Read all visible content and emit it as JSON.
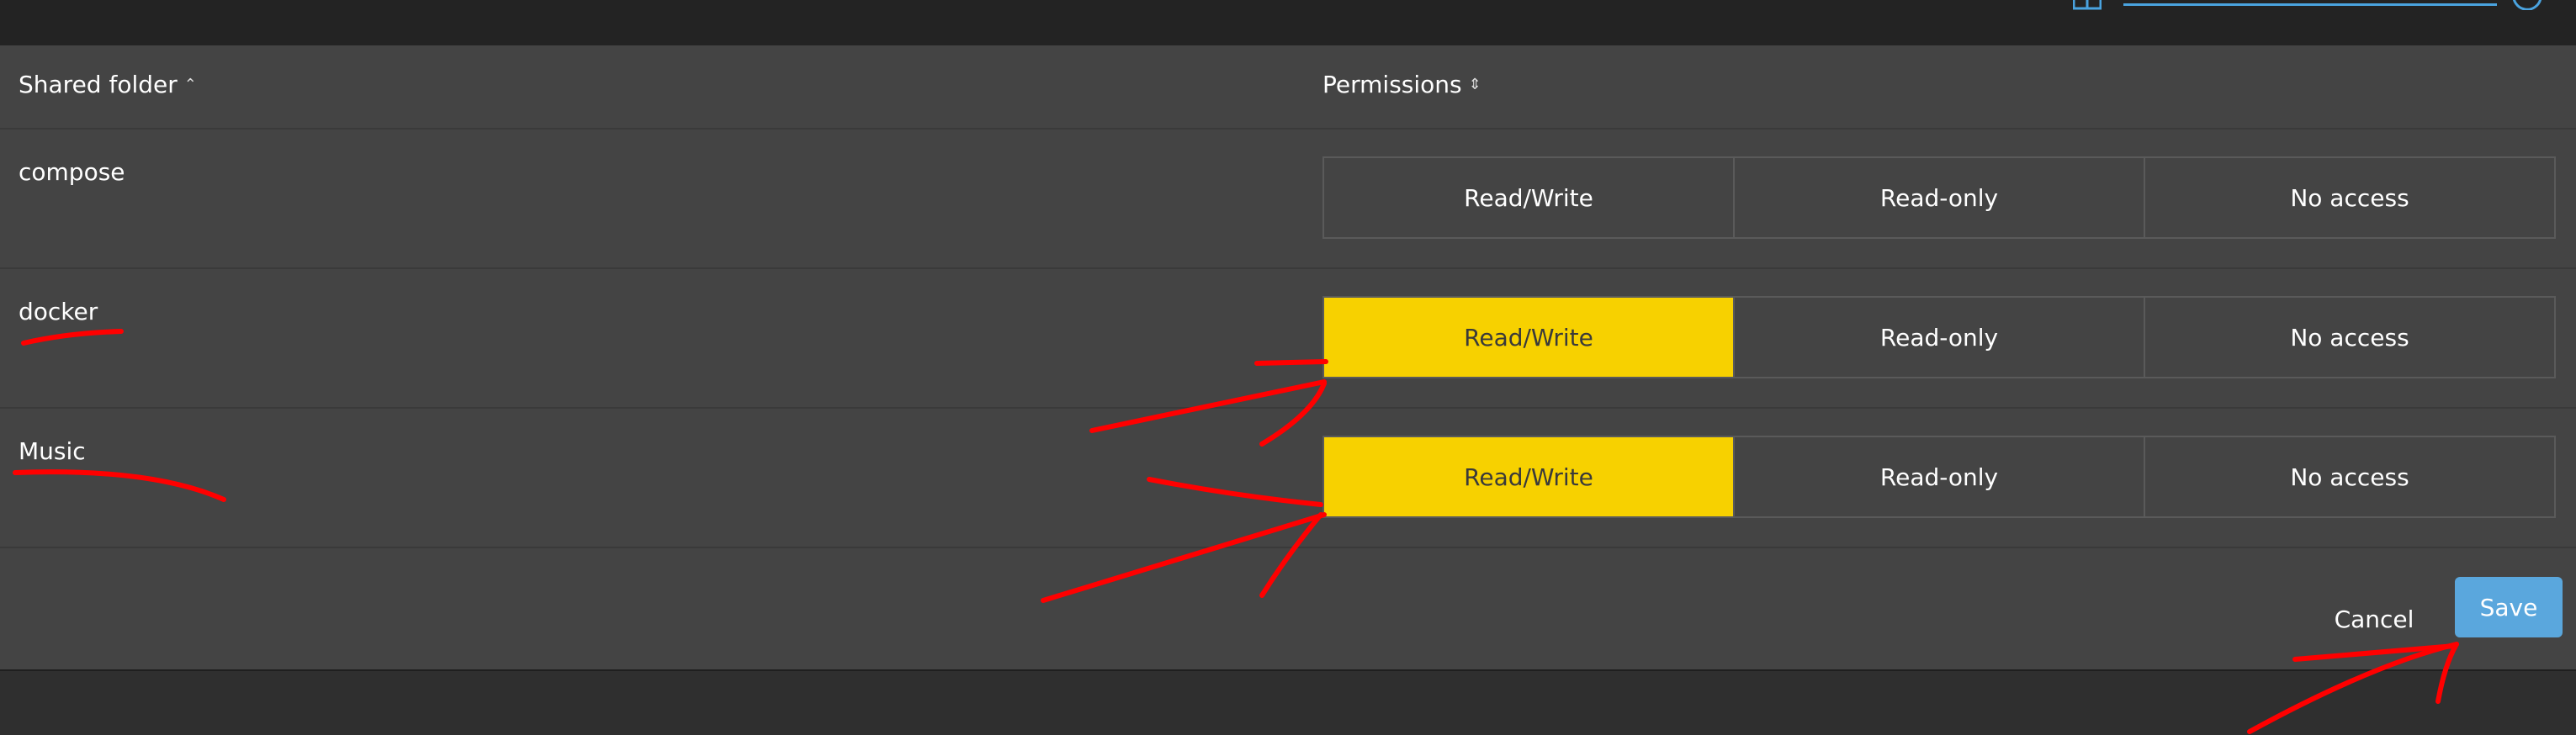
{
  "table": {
    "header": {
      "folder_label": "Shared folder",
      "folder_sort_icon": "chevron-up-icon",
      "permissions_label": "Permissions",
      "permissions_sort_icon": "sort-updown-icon"
    },
    "rows": [
      {
        "name": "compose",
        "options": [
          "Read/Write",
          "Read-only",
          "No access"
        ],
        "selected": ""
      },
      {
        "name": "docker",
        "options": [
          "Read/Write",
          "Read-only",
          "No access"
        ],
        "selected": "Read/Write"
      },
      {
        "name": "Music",
        "options": [
          "Read/Write",
          "Read-only",
          "No access"
        ],
        "selected": "Read/Write"
      }
    ]
  },
  "actions": {
    "cancel_label": "Cancel",
    "save_label": "Save"
  },
  "colors": {
    "selected": "#f7d100",
    "save_button": "#5aa7dd",
    "annotation": "#ff0000"
  }
}
